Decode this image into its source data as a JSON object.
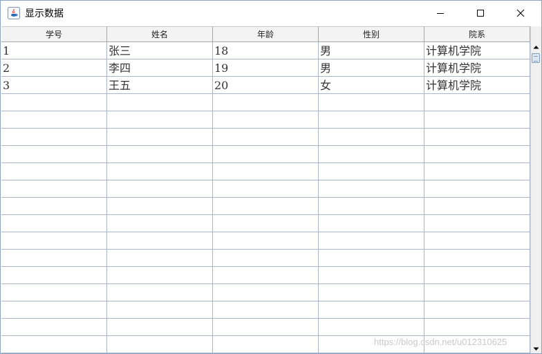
{
  "window": {
    "title": "显示数据",
    "controls": {
      "minimize_icon": "minimize-icon",
      "maximize_icon": "maximize-icon",
      "close_icon": "close-icon"
    }
  },
  "table": {
    "columns": [
      "学号",
      "姓名",
      "年龄",
      "性别",
      "院系"
    ],
    "rows": [
      [
        "1",
        "张三",
        "18",
        "男",
        "计算机学院"
      ],
      [
        "2",
        "李四",
        "19",
        "男",
        "计算机学院"
      ],
      [
        "3",
        "王五",
        "20",
        "女",
        "计算机学院"
      ],
      [
        "",
        "",
        "",
        "",
        ""
      ],
      [
        "",
        "",
        "",
        "",
        ""
      ],
      [
        "",
        "",
        "",
        "",
        ""
      ],
      [
        "",
        "",
        "",
        "",
        ""
      ],
      [
        "",
        "",
        "",
        "",
        ""
      ],
      [
        "",
        "",
        "",
        "",
        ""
      ],
      [
        "",
        "",
        "",
        "",
        ""
      ],
      [
        "",
        "",
        "",
        "",
        ""
      ],
      [
        "",
        "",
        "",
        "",
        ""
      ],
      [
        "",
        "",
        "",
        "",
        ""
      ],
      [
        "",
        "",
        "",
        "",
        ""
      ],
      [
        "",
        "",
        "",
        "",
        ""
      ],
      [
        "",
        "",
        "",
        "",
        ""
      ],
      [
        "",
        "",
        "",
        "",
        ""
      ],
      [
        "",
        "",
        "",
        "",
        ""
      ],
      [
        "",
        "",
        "",
        "",
        ""
      ]
    ]
  },
  "watermark": "https://blog.csdn.net/u012310625",
  "colors": {
    "header_bg": "#f3f3f3",
    "grid_line": "#a9b5c9",
    "border": "#8aa4c2"
  }
}
